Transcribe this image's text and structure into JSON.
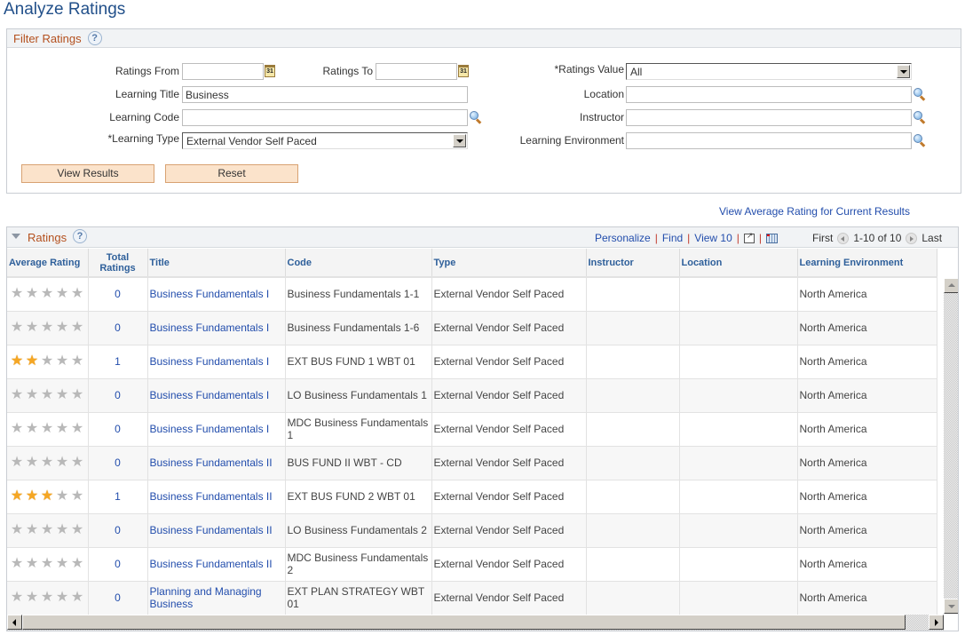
{
  "page": {
    "title": "Analyze Ratings"
  },
  "filter": {
    "section_title": "Filter Ratings",
    "ratings_from": {
      "label": "Ratings From",
      "value": ""
    },
    "ratings_to": {
      "label": "Ratings To",
      "value": ""
    },
    "ratings_value": {
      "label": "*Ratings Value",
      "value": "All"
    },
    "learning_title": {
      "label": "Learning Title",
      "value": "Business"
    },
    "location": {
      "label": "Location",
      "value": ""
    },
    "learning_code": {
      "label": "Learning Code",
      "value": ""
    },
    "instructor": {
      "label": "Instructor",
      "value": ""
    },
    "learning_type": {
      "label": "*Learning Type",
      "value": "External Vendor Self Paced"
    },
    "learning_environment": {
      "label": "Learning Environment",
      "value": ""
    },
    "calendar_icon_text": "31",
    "view_results_label": "View Results",
    "reset_label": "Reset"
  },
  "avg_link": "View Average Rating for Current Results",
  "grid": {
    "section_title": "Ratings",
    "help_glyph": "?",
    "tools": {
      "personalize": "Personalize",
      "find": "Find",
      "view": "View 10",
      "separator": "|"
    },
    "pager": {
      "first": "First",
      "range": "1-10 of 10",
      "last": "Last"
    },
    "columns": [
      "Average Rating",
      "Total Ratings",
      "Title",
      "Code",
      "Type",
      "Instructor",
      "Location",
      "Learning Environment"
    ],
    "rows": [
      {
        "stars": 0,
        "total": "0",
        "title": "Business Fundamentals I",
        "code": "Business Fundamentals 1-1",
        "type": "External Vendor Self Paced",
        "instructor": "",
        "location": "",
        "env": "North America"
      },
      {
        "stars": 0,
        "total": "0",
        "title": "Business Fundamentals I",
        "code": "Business Fundamentals 1-6",
        "type": "External Vendor Self Paced",
        "instructor": "",
        "location": "",
        "env": "North America"
      },
      {
        "stars": 2,
        "total": "1",
        "title": "Business Fundamentals I",
        "code": "EXT BUS FUND 1 WBT 01",
        "type": "External Vendor Self Paced",
        "instructor": "",
        "location": "",
        "env": "North America"
      },
      {
        "stars": 0,
        "total": "0",
        "title": "Business Fundamentals I",
        "code": "LO Business Fundamentals 1",
        "type": "External Vendor Self Paced",
        "instructor": "",
        "location": "",
        "env": "North America"
      },
      {
        "stars": 0,
        "total": "0",
        "title": "Business Fundamentals I",
        "code": "MDC Business Fundamentals 1",
        "type": "External Vendor Self Paced",
        "instructor": "",
        "location": "",
        "env": "North America"
      },
      {
        "stars": 0,
        "total": "0",
        "title": "Business Fundamentals II",
        "code": "BUS FUND II WBT - CD",
        "type": "External Vendor Self Paced",
        "instructor": "",
        "location": "",
        "env": "North America"
      },
      {
        "stars": 3,
        "total": "1",
        "title": "Business Fundamentals II",
        "code": "EXT BUS FUND 2 WBT 01",
        "type": "External Vendor Self Paced",
        "instructor": "",
        "location": "",
        "env": "North America"
      },
      {
        "stars": 0,
        "total": "0",
        "title": "Business Fundamentals II",
        "code": "LO Business Fundamentals 2",
        "type": "External Vendor Self Paced",
        "instructor": "",
        "location": "",
        "env": "North America"
      },
      {
        "stars": 0,
        "total": "0",
        "title": "Business Fundamentals II",
        "code": "MDC Business Fundamentals 2",
        "type": "External Vendor Self Paced",
        "instructor": "",
        "location": "",
        "env": "North America"
      },
      {
        "stars": 0,
        "total": "0",
        "title": "Planning and Managing Business",
        "code": "EXT PLAN STRATEGY WBT 01",
        "type": "External Vendor Self Paced",
        "instructor": "",
        "location": "",
        "env": "North America"
      }
    ],
    "max_stars": 5,
    "star_glyph": "★"
  }
}
